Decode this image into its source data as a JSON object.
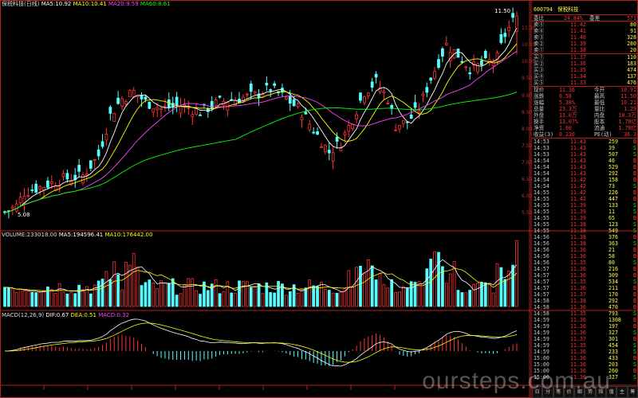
{
  "main": {
    "legend": {
      "name": "保税科技(日线)",
      "ma5": "MA5:10.92",
      "ma10": "MA10:10.41",
      "ma20": "MA20:9.59",
      "ma60": "MA60:8.61"
    },
    "high_label": "11.50",
    "low_label": "5.08"
  },
  "volume": {
    "legend": {
      "vol": "VOLUME:233018.00",
      "ma5": "MA5:194596.41",
      "ma10": "MA10:176442.00"
    }
  },
  "macd": {
    "legend": {
      "name": "MACD(12,26,9)",
      "dif": "DIF:0.67",
      "dea": "DEA:0.51",
      "macd": "MACD:0.32"
    }
  },
  "right_panel": {
    "code": "600794",
    "name": "保税科技",
    "wei": {
      "l1": "委比",
      "v1": "24.84%",
      "l2": "委差",
      "v2": "571"
    },
    "asks": [
      {
        "label": "卖⑤",
        "price": "11.42",
        "vol": "80"
      },
      {
        "label": "卖④",
        "price": "11.41",
        "vol": "91"
      },
      {
        "label": "卖③",
        "price": "11.40",
        "vol": "328"
      },
      {
        "label": "卖②",
        "price": "11.39",
        "vol": "280"
      },
      {
        "label": "卖①",
        "price": "11.38",
        "vol": "20"
      }
    ],
    "bids": [
      {
        "label": "买①",
        "price": "11.37",
        "vol": "110"
      },
      {
        "label": "买②",
        "price": "11.36",
        "vol": "183"
      },
      {
        "label": "买③",
        "price": "11.35",
        "vol": "474"
      },
      {
        "label": "买④",
        "price": "11.34",
        "vol": "137"
      },
      {
        "label": "买⑤",
        "price": "11.33",
        "vol": "476"
      }
    ],
    "quote": [
      {
        "l1": "现价",
        "v1": "11.36",
        "l2": "今开",
        "v2": "10.91"
      },
      {
        "l1": "涨跌",
        "v1": "0.58",
        "l2": "最高",
        "v2": "11.50"
      },
      {
        "l1": "涨幅",
        "v1": "5.38%",
        "l2": "最低",
        "v2": "10.21"
      },
      {
        "l1": "总量",
        "v1": "23.3万",
        "l2": "量比",
        "v2": "1.29"
      },
      {
        "l1": "外盘",
        "v1": "13.0万",
        "l2": "内盘",
        "v2": "10.3万"
      },
      {
        "l1": "换手",
        "v1": "13.07%",
        "l2": "股本",
        "v2": "1.78亿"
      },
      {
        "l1": "净资",
        "v1": "1.60",
        "l2": "流通",
        "v2": "1.78亿"
      },
      {
        "l1": "收益(3)",
        "v1": "0.230",
        "l2": "PE(动)",
        "v2": "36.3"
      }
    ],
    "ticks": [
      {
        "t": "14:53",
        "p": "11.43",
        "v": "259",
        "s": "B"
      },
      {
        "t": "14:53",
        "p": "11.43",
        "v": "39",
        "s": "S"
      },
      {
        "t": "14:53",
        "p": "11.43",
        "v": "507",
        "s": "S"
      },
      {
        "t": "14:54",
        "p": "11.43",
        "v": "46",
        "s": "B"
      },
      {
        "t": "14:54",
        "p": "11.43",
        "v": "529",
        "s": "B"
      },
      {
        "t": "14:54",
        "p": "11.43",
        "v": "292",
        "s": "B"
      },
      {
        "t": "14:54",
        "p": "11.42",
        "v": "158",
        "s": "B"
      },
      {
        "t": "14:54",
        "p": "11.42",
        "v": "73",
        "s": "S"
      },
      {
        "t": "14:55",
        "p": "11.42",
        "v": "226",
        "s": "B"
      },
      {
        "t": "14:55",
        "p": "11.42",
        "v": "447",
        "s": "B"
      },
      {
        "t": "14:55",
        "p": "11.39",
        "v": "133",
        "s": "S"
      },
      {
        "t": "14:55",
        "p": "11.39",
        "v": "11",
        "s": "S"
      },
      {
        "t": "14:55",
        "p": "11.39",
        "v": "65",
        "s": "B"
      },
      {
        "t": "14:55",
        "p": "11.38",
        "v": "123",
        "s": "S"
      },
      {
        "t": "14:55",
        "p": "11.38",
        "v": "549",
        "s": "S"
      },
      {
        "t": "14:56",
        "p": "11.38",
        "v": "376",
        "s": "B"
      },
      {
        "t": "14:56",
        "p": "11.38",
        "v": "363",
        "s": "S"
      },
      {
        "t": "14:56",
        "p": "11.36",
        "v": "21",
        "s": "B"
      },
      {
        "t": "14:56",
        "p": "11.36",
        "v": "58",
        "s": "B"
      },
      {
        "t": "14:56",
        "p": "11.35",
        "v": "80",
        "s": "S"
      },
      {
        "t": "14:57",
        "p": "11.36",
        "v": "216",
        "s": "B"
      },
      {
        "t": "14:57",
        "p": "11.36",
        "v": "309",
        "s": "B"
      },
      {
        "t": "14:57",
        "p": "11.35",
        "v": "534",
        "s": "S"
      },
      {
        "t": "14:57",
        "p": "11.36",
        "v": "211",
        "s": "B"
      },
      {
        "t": "14:57",
        "p": "11.37",
        "v": "170",
        "s": "B"
      },
      {
        "t": "14:58",
        "p": "11.38",
        "v": "292",
        "s": "B"
      },
      {
        "t": "14:58",
        "p": "11.36",
        "v": "470",
        "s": "B"
      },
      {
        "t": "14:58",
        "p": "11.35",
        "v": "793",
        "s": "S"
      },
      {
        "t": "14:59",
        "p": "11.36",
        "v": "1308",
        "s": "B"
      },
      {
        "t": "14:59",
        "p": "11.36",
        "v": "197",
        "s": "B"
      },
      {
        "t": "14:59",
        "p": "11.36",
        "v": "327",
        "s": "S"
      },
      {
        "t": "14:59",
        "p": "11.37",
        "v": "301",
        "s": "B"
      },
      {
        "t": "14:59",
        "p": "11.35",
        "v": "454",
        "s": "S"
      },
      {
        "t": "14:59",
        "p": "11.36",
        "v": "233",
        "s": "S"
      },
      {
        "t": "15:00",
        "p": "11.36",
        "v": "433",
        "s": "B"
      },
      {
        "t": "15:00",
        "p": "11.36",
        "v": "203",
        "s": "S"
      },
      {
        "t": "15:00",
        "p": "11.36",
        "v": "260",
        "s": "B"
      },
      {
        "t": "15:00",
        "p": "11.36",
        "v": "327",
        "s": "S"
      }
    ],
    "tabs": [
      "日线",
      "分时",
      "笔",
      "价",
      "细",
      "势",
      "指",
      "值",
      "主",
      "筹"
    ]
  },
  "watermark": "oursteps.com.au",
  "colors": {
    "up": "#ff3333",
    "down": "#55ffff",
    "ma5": "#ffffff",
    "ma10": "#ffff00",
    "ma20": "#ff44ff",
    "ma60": "#00ff00",
    "label": "#ffff44",
    "frame": "#b02020"
  },
  "chart_data": {
    "type": "candlestick",
    "ylim": [
      5.0,
      11.6
    ],
    "vol_max": 240000,
    "macd_range": [
      -0.8,
      0.8
    ],
    "n": 110,
    "close_path": [
      [
        0,
        5.5
      ],
      [
        3,
        5.7
      ],
      [
        5,
        6.1
      ],
      [
        10,
        6.3
      ],
      [
        15,
        6.5
      ],
      [
        20,
        6.6
      ],
      [
        24,
        7.2
      ],
      [
        27,
        8.4
      ],
      [
        30,
        8.9
      ],
      [
        33,
        9.1
      ],
      [
        36,
        8.8
      ],
      [
        40,
        8.6
      ],
      [
        45,
        8.7
      ],
      [
        50,
        8.5
      ],
      [
        55,
        8.8
      ],
      [
        60,
        8.9
      ],
      [
        64,
        9.0
      ],
      [
        68,
        9.2
      ],
      [
        72,
        8.9
      ],
      [
        76,
        8.5
      ],
      [
        80,
        7.8
      ],
      [
        83,
        7.3
      ],
      [
        86,
        7.6
      ],
      [
        89,
        8.3
      ],
      [
        92,
        9.1
      ],
      [
        95,
        9.4
      ],
      [
        98,
        8.9
      ],
      [
        100,
        8.1
      ],
      [
        103,
        8.2
      ],
      [
        106,
        8.6
      ],
      [
        109,
        9.5
      ],
      [
        113,
        10.5
      ],
      [
        116,
        10.2
      ],
      [
        119,
        9.8
      ],
      [
        122,
        9.9
      ],
      [
        126,
        10.1
      ],
      [
        128,
        10.8
      ],
      [
        130,
        11.2
      ],
      [
        131,
        11.36
      ]
    ]
  }
}
